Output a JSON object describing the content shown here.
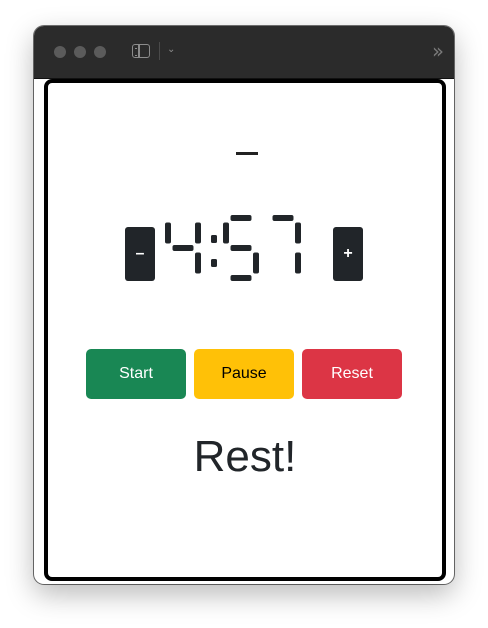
{
  "window": {
    "controls": [
      "close",
      "minimize",
      "zoom"
    ],
    "toolbar_icons": [
      "sidebar-icon",
      "chevron-down-icon",
      "overflow-chevron-icon"
    ]
  },
  "timer": {
    "label": "—",
    "display": "4:57",
    "minutes": 4,
    "seconds": 57,
    "decrement_label": "–",
    "increment_label": "+"
  },
  "controls": {
    "start_label": "Start",
    "pause_label": "Pause",
    "reset_label": "Reset",
    "colors": {
      "start": "#198754",
      "pause": "#ffc107",
      "reset": "#dc3545"
    }
  },
  "status": {
    "text": "Rest!"
  }
}
